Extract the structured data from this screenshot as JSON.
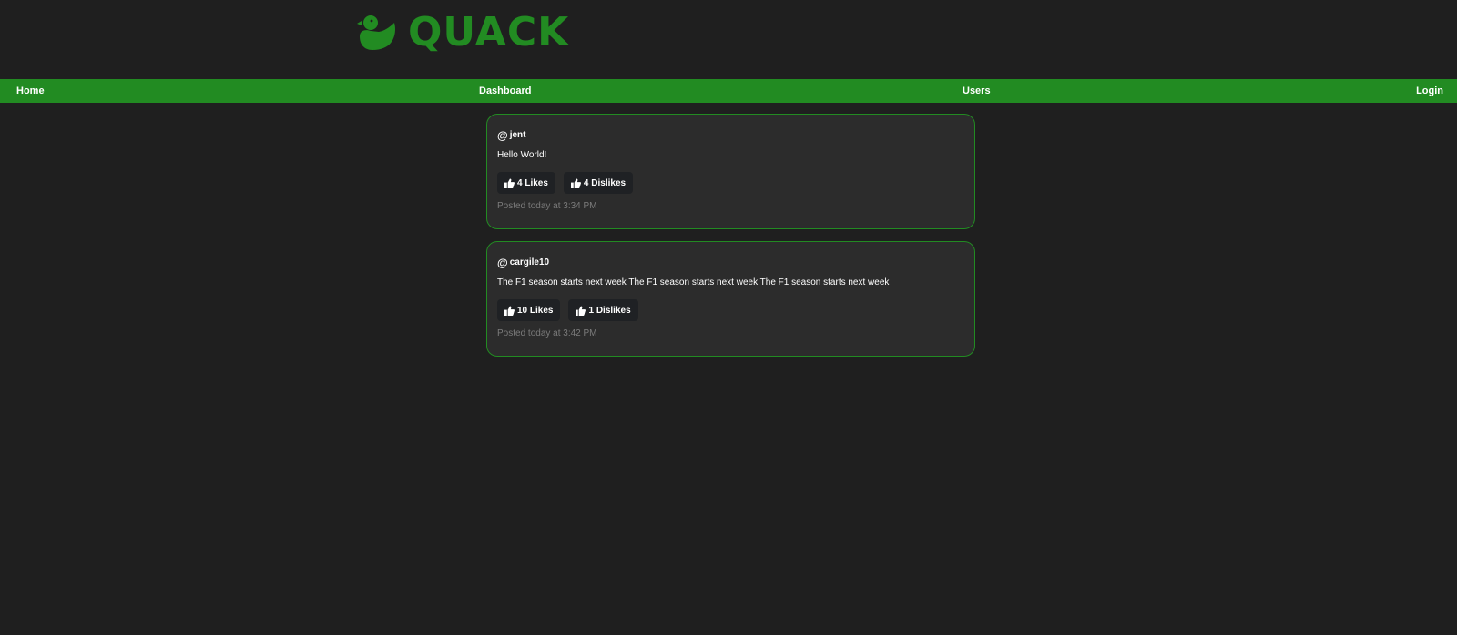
{
  "brand": {
    "name": "QUACK",
    "icon": "duck-icon",
    "color": "#228b22"
  },
  "nav": {
    "home": "Home",
    "dashboard": "Dashboard",
    "users": "Users",
    "login": "Login"
  },
  "posts": [
    {
      "username": "jent",
      "text": "Hello World!",
      "likes": "4 Likes",
      "dislikes": "4 Dislikes",
      "time": "Posted today at 3:34 PM"
    },
    {
      "username": "cargile10",
      "text": "The F1 season starts next week The F1 season starts next week The F1 season starts next week",
      "likes": "10 Likes",
      "dislikes": "1 Dislikes",
      "time": "Posted today at 3:42 PM"
    }
  ],
  "colors": {
    "background": "#1f1f1f",
    "accent": "#228b22",
    "card": "#2c2c2c"
  }
}
